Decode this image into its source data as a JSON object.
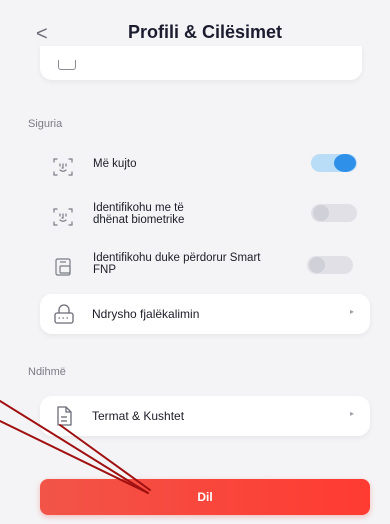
{
  "header": {
    "back_symbol": "<",
    "title": "Profili & Cilësimet"
  },
  "sections": {
    "security_label": "Siguria",
    "help_label": "Ndihmë"
  },
  "security": {
    "remember_me": {
      "label": "Më kujto",
      "enabled": true
    },
    "biometric": {
      "label": "Identifikohu me të dhënat biometrike",
      "enabled": false
    },
    "smart_fnp": {
      "label": "Identifikohu duke përdorur Smart FNP",
      "enabled": false
    },
    "change_password": {
      "label": "Ndrysho fjalëkalimin",
      "arrow": "▸"
    }
  },
  "help": {
    "terms": {
      "label": "Termat & Kushtet",
      "arrow": "▸"
    }
  },
  "logout": {
    "label": "Dil"
  },
  "colors": {
    "accent": "#2f90ea",
    "logout": "#f44336",
    "annotation": "#a01010"
  }
}
